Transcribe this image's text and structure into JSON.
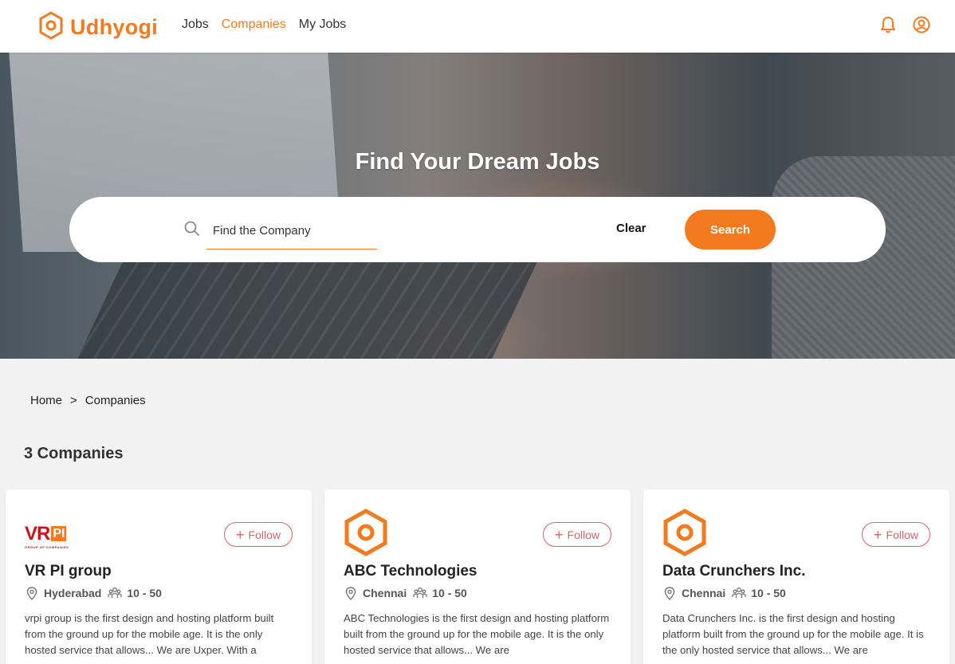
{
  "header": {
    "brand": "Udhyogi",
    "nav": [
      {
        "label": "Jobs",
        "active": false
      },
      {
        "label": "Companies",
        "active": true
      },
      {
        "label": "My Jobs",
        "active": false
      }
    ],
    "icons": [
      "bell-icon",
      "user-icon"
    ]
  },
  "hero": {
    "title": "Find Your Dream Jobs",
    "search": {
      "placeholder": "Find the Company",
      "value": "",
      "clear_label": "Clear",
      "search_label": "Search"
    }
  },
  "breadcrumb": {
    "home": "Home",
    "separator": ">",
    "current": "Companies"
  },
  "results": {
    "count_label": "3 Companies"
  },
  "follow_label": "Follow",
  "companies": [
    {
      "logo_text": "VR",
      "logo_badge": "PI",
      "logo_tagline": "GROUP OF COMPANIES",
      "name": "VR PI group",
      "location": "Hyderabad",
      "size": "10 - 50",
      "description": "vrpi group is the first design and hosting platform built from the ground up for the mobile age. It is the only hosted service that allows... We are Uxper. With a"
    },
    {
      "name": "ABC Technologies",
      "location": "Chennai",
      "size": "10 - 50",
      "description": "ABC Technologies is the first design and hosting platform built from the ground up for the mobile age. It is the only hosted service that allows... We are"
    },
    {
      "name": "Data Crunchers Inc.",
      "location": "Chennai",
      "size": "10 - 50",
      "description": "Data Crunchers Inc. is the first design and hosting platform built from the ground up for the mobile age. It is the only hosted service that allows... We are"
    }
  ],
  "colors": {
    "accent": "#f47a20",
    "follow": "#e0606b",
    "background": "#f2f2f2"
  }
}
